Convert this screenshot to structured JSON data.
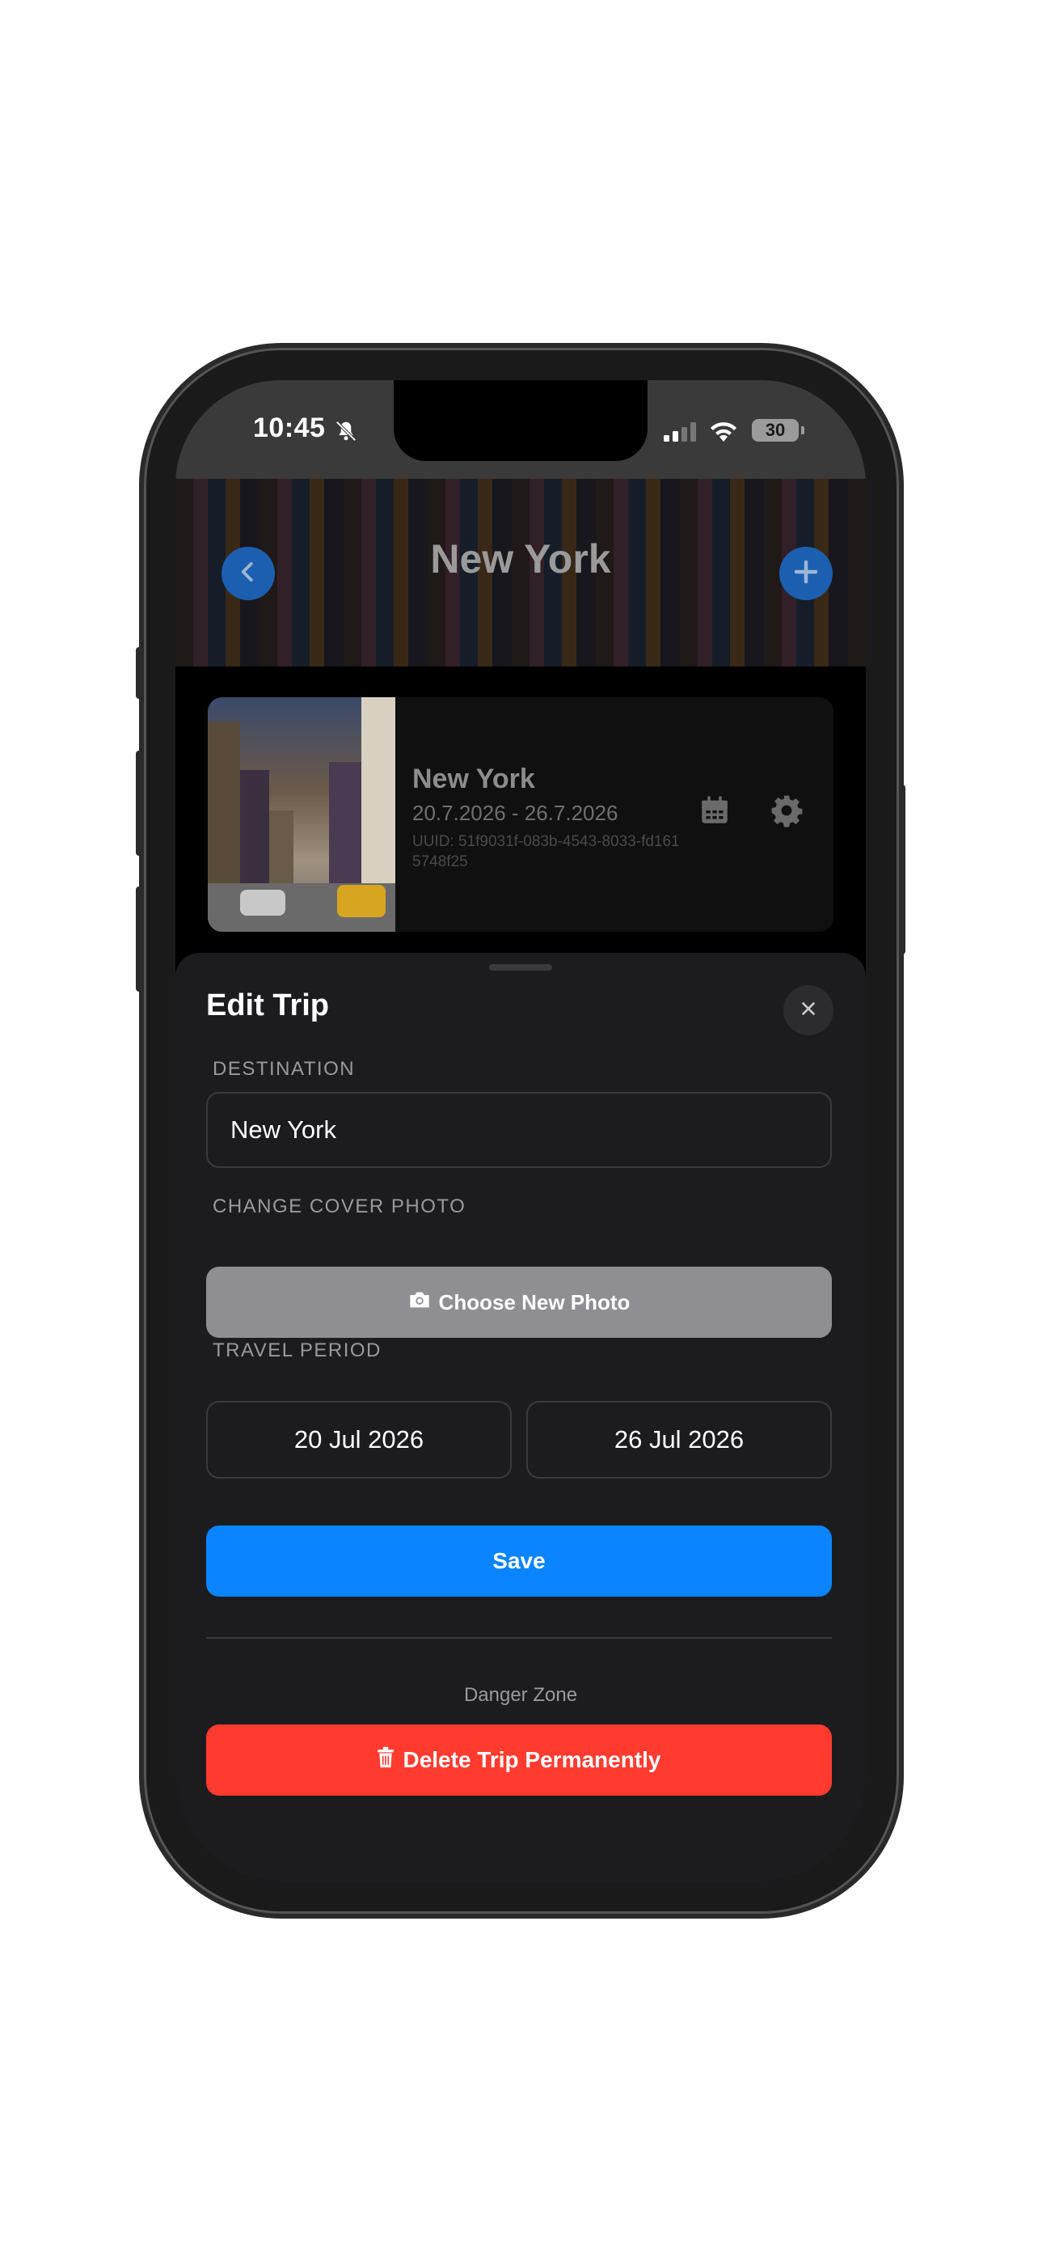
{
  "status_bar": {
    "time": "10:45",
    "battery": "30"
  },
  "header": {
    "title": "New York"
  },
  "trip_card": {
    "name": "New York",
    "dates": "20.7.2026 - 26.7.2026",
    "uuid": "UUID: 51f9031f-083b-4543-8033-fd1615748f25"
  },
  "sheet": {
    "title": "Edit Trip",
    "destination_label": "DESTINATION",
    "destination_value": "New York",
    "cover_label": "CHANGE COVER PHOTO",
    "choose_photo_label": "Choose New Photo",
    "period_label": "TRAVEL PERIOD",
    "start_date": "20 Jul 2026",
    "end_date": "26 Jul 2026",
    "save_label": "Save",
    "danger_label": "Danger Zone",
    "delete_label": "Delete Trip Permanently"
  },
  "colors": {
    "accent": "#0a84ff",
    "danger": "#ff3b30",
    "sheet_bg": "#1c1c1e",
    "photo_button": "#8e8e93"
  },
  "icons": [
    "bell-slash-icon",
    "signal-icon",
    "wifi-icon",
    "chevron-left-icon",
    "plus-icon",
    "calendar-icon",
    "gear-icon",
    "close-icon",
    "camera-icon",
    "trash-icon"
  ]
}
